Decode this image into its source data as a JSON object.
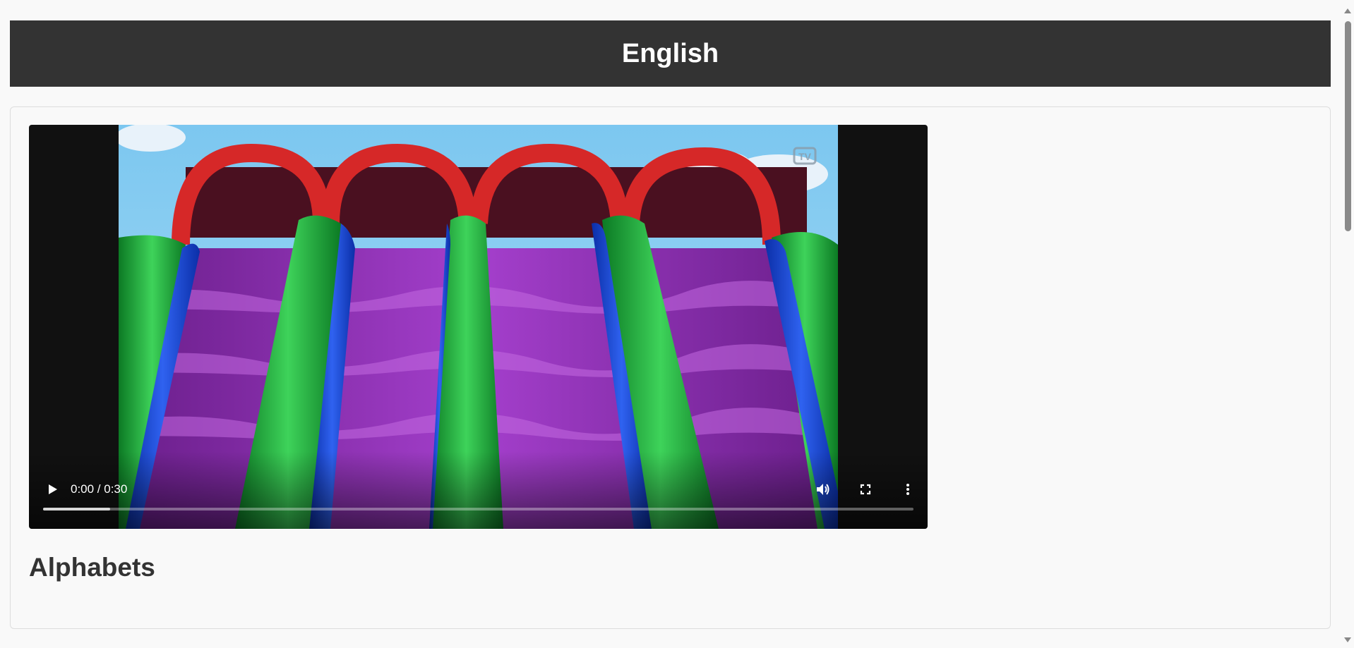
{
  "header": {
    "title": "English"
  },
  "video": {
    "time_display": "0:00 / 0:30",
    "buffered_fraction": 0.077,
    "watermark": "TV",
    "icons": {
      "play": "play-icon",
      "volume": "volume-icon",
      "fullscreen": "fullscreen-icon",
      "more": "more-options-icon"
    }
  },
  "section": {
    "title": "Alphabets"
  },
  "colors": {
    "header_bg": "#333333",
    "page_bg": "#f9f9f9",
    "title_text": "#333333"
  }
}
